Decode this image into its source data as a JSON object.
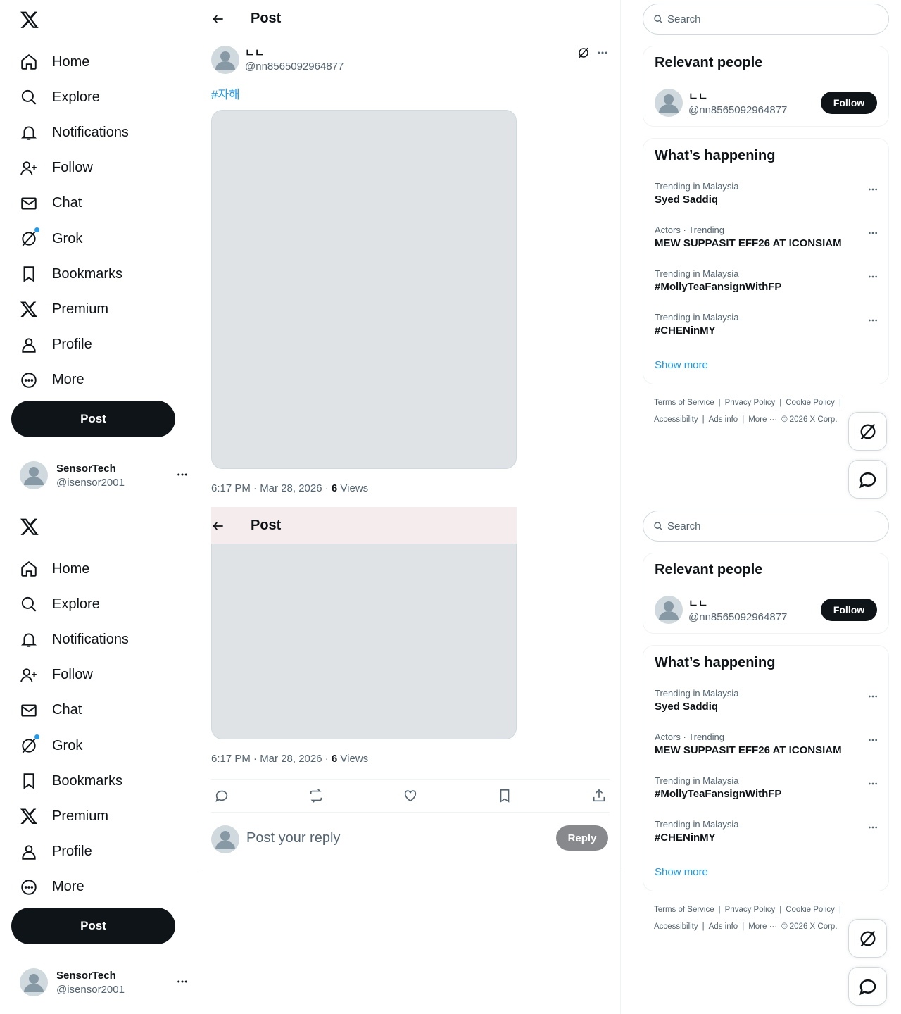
{
  "nav": {
    "items": [
      {
        "label": "Home",
        "icon": "home-icon"
      },
      {
        "label": "Explore",
        "icon": "search-icon"
      },
      {
        "label": "Notifications",
        "icon": "bell-icon"
      },
      {
        "label": "Follow",
        "icon": "follow-icon"
      },
      {
        "label": "Chat",
        "icon": "mail-icon"
      },
      {
        "label": "Grok",
        "icon": "grok-icon"
      },
      {
        "label": "Bookmarks",
        "icon": "bookmark-icon"
      },
      {
        "label": "Premium",
        "icon": "x-icon"
      },
      {
        "label": "Profile",
        "icon": "profile-icon"
      },
      {
        "label": "More",
        "icon": "more-circle-icon"
      }
    ],
    "post_label": "Post"
  },
  "account": {
    "name": "SensorTech",
    "handle": "@isensor2001"
  },
  "header": {
    "title": "Post"
  },
  "post": {
    "author_name": "ㄴㄴ",
    "author_handle": "@nn8565092964877",
    "text": "#자해",
    "timestamp": "6:17 PM · Mar 28, 2026 · ",
    "views_count": "6",
    "views_label": " Views",
    "media_note": "[Image not reproduced: self-harm content]"
  },
  "reply": {
    "placeholder": "Post your reply",
    "button": "Reply"
  },
  "sidebar": {
    "search_placeholder": "Search",
    "relevant_title": "Relevant people",
    "person_name": "ㄴㄴ",
    "person_handle": "@nn8565092964877",
    "follow_label": "Follow",
    "happening_title": "What’s happening",
    "trends": [
      {
        "context": "Trending in Malaysia",
        "topic": "Syed Saddiq"
      },
      {
        "context": "Actors · Trending",
        "topic": "MEW SUPPASIT EFF26 AT ICONSIAM"
      },
      {
        "context": "Trending in Malaysia",
        "topic": "#MollyTeaFansignWithFP"
      },
      {
        "context": "Trending in Malaysia",
        "topic": "#CHENinMY"
      }
    ],
    "show_more": "Show more",
    "footer1": [
      "Terms of Service",
      "|",
      "Privacy Policy",
      "|",
      "Cookie Policy",
      "|"
    ],
    "footer2": [
      "Accessibility",
      "|",
      "Ads info",
      "|",
      "More ···",
      "© 2026 X Corp."
    ]
  },
  "colors": {
    "accent": "#1d9bf0",
    "text": "#0f1419",
    "muted": "#536471"
  }
}
